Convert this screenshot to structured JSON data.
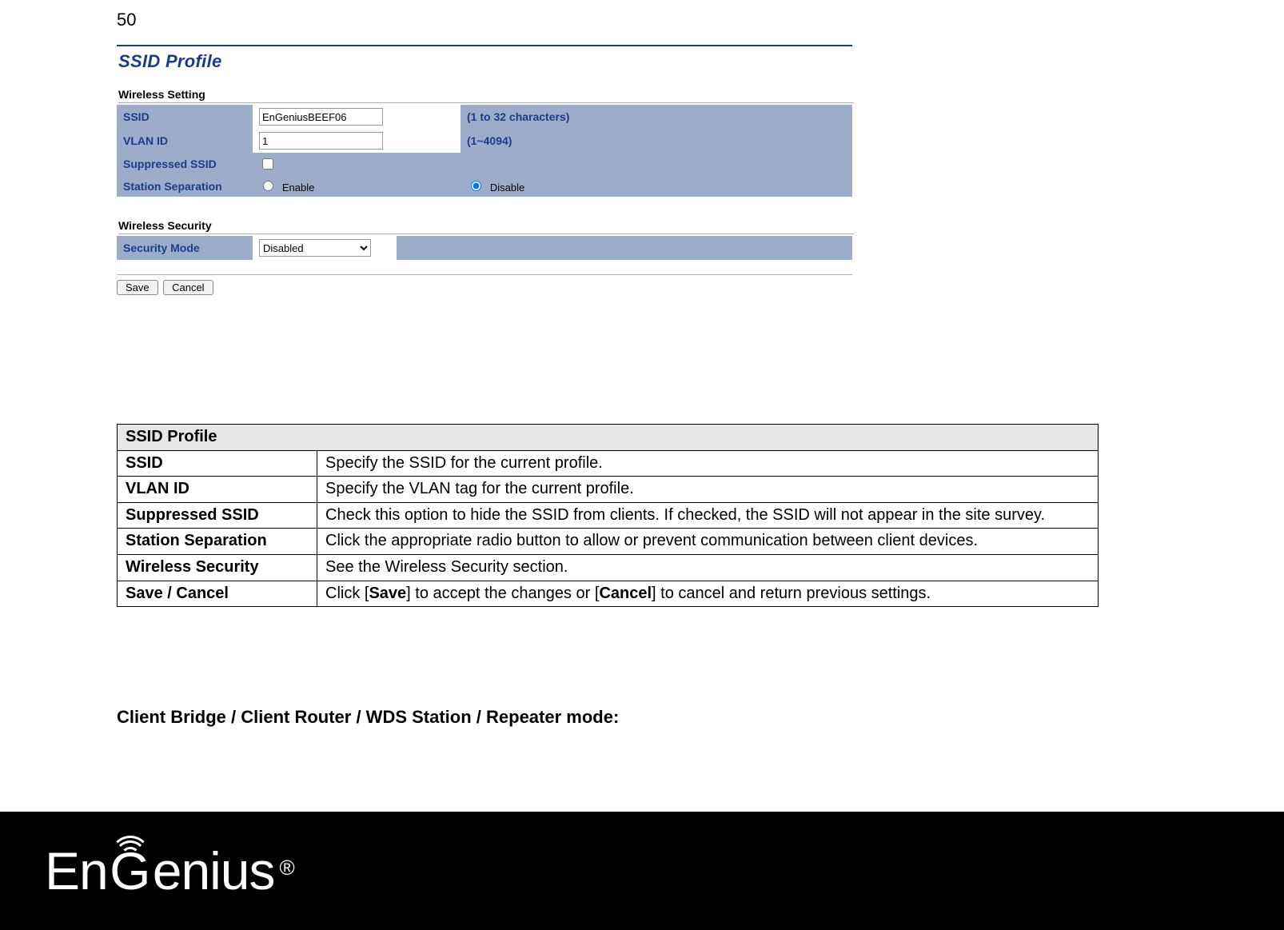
{
  "page_number": "50",
  "profile": {
    "title": "SSID Profile",
    "sections": {
      "wireless_setting_label": "Wireless Setting",
      "wireless_security_label": "Wireless Security"
    },
    "fields": {
      "ssid_label": "SSID",
      "ssid_value": "EnGeniusBEEF06",
      "ssid_hint": "(1 to 32 characters)",
      "vlan_label": "VLAN ID",
      "vlan_value": "1",
      "vlan_hint": "(1~4094)",
      "suppressed_label": "Suppressed SSID",
      "station_sep_label": "Station Separation",
      "enable_label": "Enable",
      "disable_label": "Disable",
      "security_mode_label": "Security Mode",
      "security_mode_value": "Disabled"
    },
    "buttons": {
      "save": "Save",
      "cancel": "Cancel"
    }
  },
  "doc_table": {
    "header": "SSID Profile",
    "rows": [
      {
        "term": "SSID",
        "desc": "Specify the SSID for the current profile."
      },
      {
        "term": "VLAN ID",
        "desc": "Specify the VLAN tag for the current profile."
      },
      {
        "term": "Suppressed SSID",
        "desc": "Check this option to hide the SSID from clients. If checked, the SSID will not appear in the site survey."
      },
      {
        "term": "Station Separation",
        "desc": "Click the appropriate radio button to allow or prevent communication between client devices."
      },
      {
        "term": "Wireless Security",
        "desc": "See the Wireless Security section."
      },
      {
        "term": "Save / Cancel",
        "desc_parts": [
          "Click [",
          "Save",
          "] to accept the changes or [",
          "Cancel",
          "] to cancel and return previous settings."
        ]
      }
    ]
  },
  "mode_heading": "Client Bridge / Client Router / WDS Station / Repeater mode:",
  "logo": {
    "part1": "En",
    "part_g": "G",
    "part2": "enius",
    "reg": "®"
  }
}
